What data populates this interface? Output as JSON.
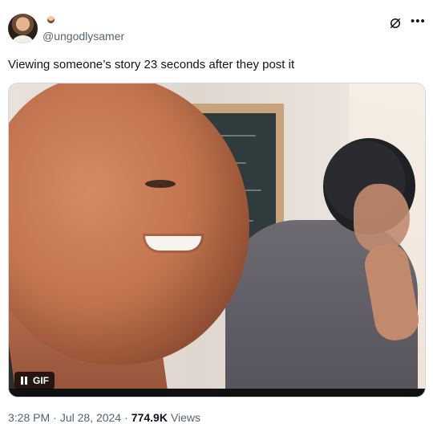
{
  "tweet": {
    "handle": "@ungodlysamer",
    "text": "Viewing someone’s story 23 seconds after they post it",
    "media": {
      "badge_label": "GIF",
      "pause_icon": "pause-icon"
    },
    "meta": {
      "time": "3:28 PM",
      "separator1": "·",
      "date": "Jul 28, 2024",
      "separator2": "·",
      "views_count": "774.9K",
      "views_label": "Views"
    }
  },
  "icons": {
    "grok": "grok-icon",
    "more": "more-options-icon"
  },
  "colors": {
    "text_primary": "#0f1419",
    "text_secondary": "#536471",
    "border": "#cfd9de"
  }
}
